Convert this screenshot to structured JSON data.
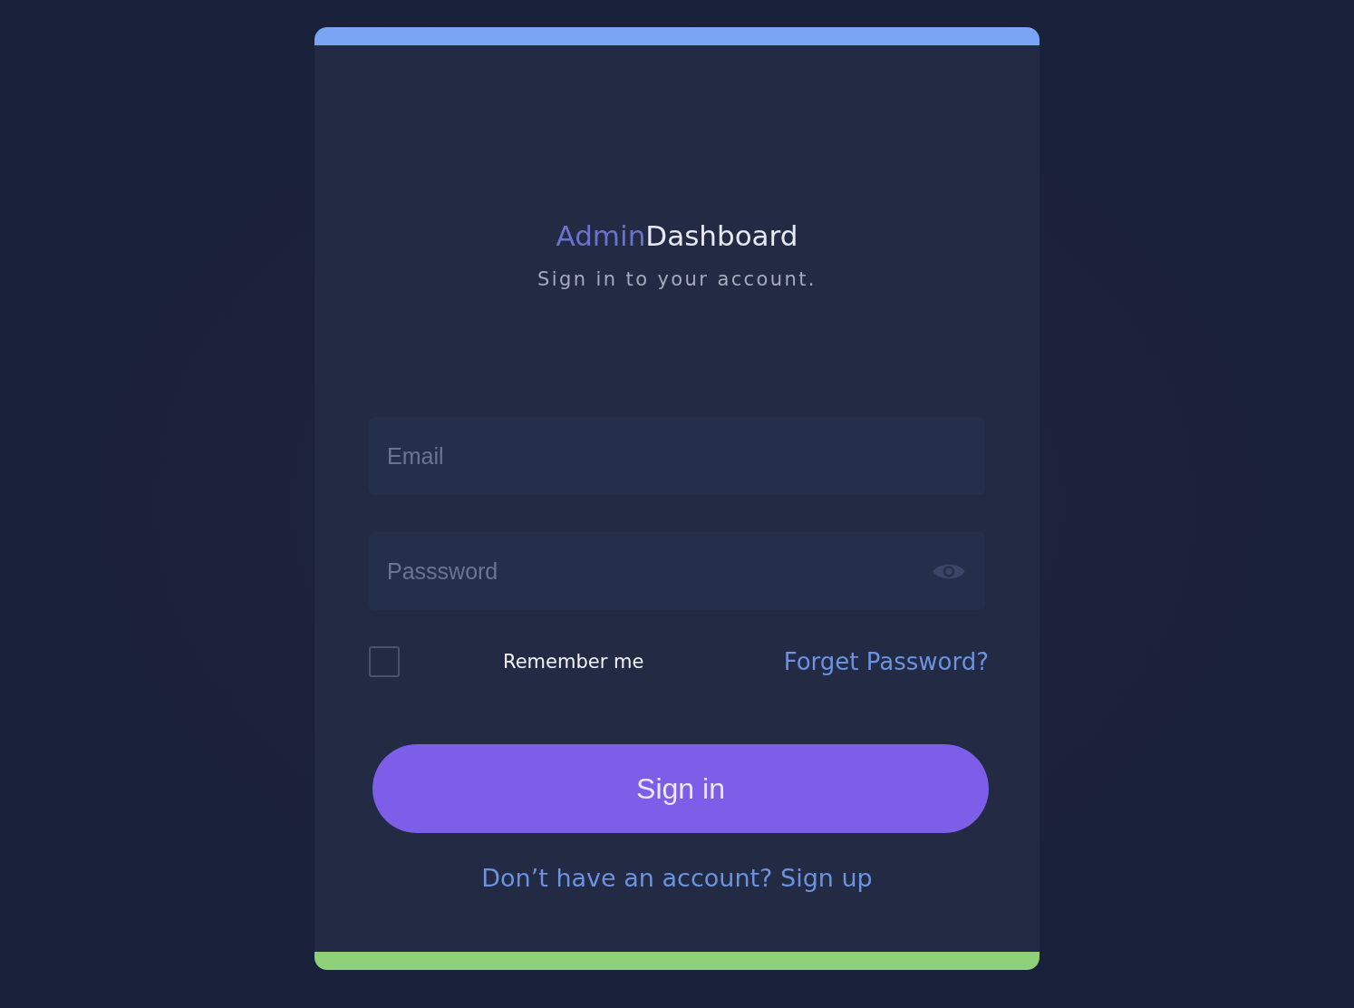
{
  "brand": {
    "prefix": "Admin",
    "name": "Dashboard"
  },
  "subtitle": "Sign in to your account.",
  "fields": [
    {
      "kind": "email",
      "placeholder": "Email"
    },
    {
      "kind": "password",
      "placeholder": "Passsword"
    }
  ],
  "remember": {
    "label": "Remember me",
    "checked": false
  },
  "forgot_link": "Forget Password?",
  "submit": "Sign in",
  "signup_link": "Don’t have an account? Sign up"
}
